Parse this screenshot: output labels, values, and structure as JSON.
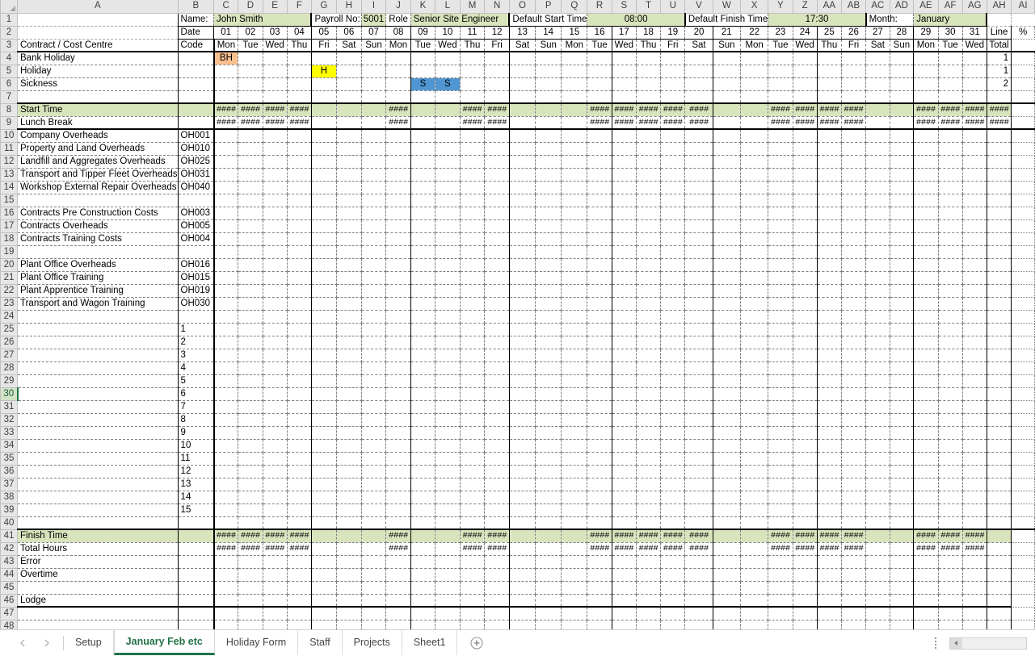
{
  "app": {
    "type": "spreadsheet",
    "active_cell_row": 30,
    "selected_row_header": "30"
  },
  "columns": [
    "A",
    "B",
    "C",
    "D",
    "E",
    "F",
    "G",
    "H",
    "I",
    "J",
    "K",
    "L",
    "M",
    "N",
    "O",
    "P",
    "Q",
    "R",
    "S",
    "T",
    "U",
    "V",
    "W",
    "X",
    "Y",
    "Z",
    "AA",
    "AB",
    "AC",
    "AD",
    "AE",
    "AF",
    "AG",
    "AH",
    "AI"
  ],
  "header": {
    "name_label": "Name:",
    "name_value": "John Smith",
    "payroll_label": "Payroll No:",
    "payroll_value": "5001",
    "role_label": "Role",
    "role_value": "Senior Site Engineer",
    "default_start_label": "Default Start Time",
    "default_start_value": "08:00",
    "default_finish_label": "Default Finish Time",
    "default_finish_value": "17:30",
    "month_label": "Month:",
    "month_value": "January",
    "date_label": "Date",
    "code_label": "Code",
    "contract_label": "Contract / Cost Centre",
    "line_total_label_1": "Line",
    "line_total_label_2": "Total",
    "percent_label": "%"
  },
  "calendar": {
    "dates": [
      "01",
      "02",
      "03",
      "04",
      "05",
      "06",
      "07",
      "08",
      "09",
      "10",
      "11",
      "12",
      "13",
      "14",
      "15",
      "16",
      "17",
      "18",
      "19",
      "20",
      "21",
      "22",
      "23",
      "24",
      "25",
      "26",
      "27",
      "28",
      "29",
      "30",
      "31"
    ],
    "days": [
      "Mon",
      "Tue",
      "Wed",
      "Thu",
      "Fri",
      "Sat",
      "Sun",
      "Mon",
      "Tue",
      "Wed",
      "Thu",
      "Fri",
      "Sat",
      "Sun",
      "Mon",
      "Tue",
      "Wed",
      "Thu",
      "Fri",
      "Sat",
      "Sun",
      "Mon",
      "Tue",
      "Wed",
      "Thu",
      "Fri",
      "Sat",
      "Sun",
      "Mon",
      "Tue",
      "Wed"
    ]
  },
  "absence_rows": [
    {
      "row": 4,
      "label": "Bank Holiday",
      "code": "",
      "total": "1",
      "marks": [
        {
          "day_index": 0,
          "text": "BH",
          "color": "#fac090"
        }
      ]
    },
    {
      "row": 5,
      "label": "Holiday",
      "code": "",
      "total": "1",
      "marks": [
        {
          "day_index": 4,
          "text": "H",
          "color": "#ffff00"
        }
      ]
    },
    {
      "row": 6,
      "label": "Sickness",
      "code": "",
      "total": "2",
      "marks": [
        {
          "day_index": 8,
          "text": "S",
          "color": "#4f96d2"
        },
        {
          "day_index": 9,
          "text": "S",
          "color": "#4f96d2"
        }
      ]
    }
  ],
  "time_rows": [
    {
      "row": 8,
      "label": "Start Time",
      "bold": true,
      "shaded": true,
      "hash_days": [
        0,
        1,
        2,
        3,
        7,
        10,
        11,
        15,
        16,
        17,
        18,
        19,
        22,
        23,
        24,
        25,
        28,
        29,
        30
      ],
      "total_hash": true
    },
    {
      "row": 9,
      "label": "Lunch Break",
      "bold": false,
      "shaded": false,
      "hash_days": [
        0,
        1,
        2,
        3,
        7,
        10,
        11,
        15,
        16,
        17,
        18,
        19,
        22,
        23,
        24,
        25,
        28,
        29,
        30
      ],
      "total_hash": true
    },
    {
      "row": 41,
      "label": "Finish Time",
      "bold": true,
      "shaded": true,
      "hash_days": [
        0,
        1,
        2,
        3,
        7,
        10,
        11,
        15,
        16,
        17,
        18,
        19,
        22,
        23,
        24,
        25,
        28,
        29,
        30
      ],
      "total_hash": false
    },
    {
      "row": 42,
      "label": "Total Hours",
      "bold": false,
      "shaded": false,
      "hash_days": [
        0,
        1,
        2,
        3,
        7,
        10,
        11,
        15,
        16,
        17,
        18,
        19,
        22,
        23,
        24,
        25,
        28,
        29,
        30
      ],
      "total_hash": false
    }
  ],
  "cost_centre_rows": [
    {
      "row": 10,
      "label": "Company Overheads",
      "code": "OH001"
    },
    {
      "row": 11,
      "label": "Property and Land Overheads",
      "code": "OH010"
    },
    {
      "row": 12,
      "label": "Landfill and Aggregates Overheads",
      "code": "OH025"
    },
    {
      "row": 13,
      "label": "Transport and Tipper Fleet Overheads",
      "code": "OH031"
    },
    {
      "row": 14,
      "label": "Workshop External Repair Overheads",
      "code": "OH040"
    },
    {
      "row": 15,
      "label": "",
      "code": ""
    },
    {
      "row": 16,
      "label": "Contracts Pre Construction Costs",
      "code": "OH003"
    },
    {
      "row": 17,
      "label": "Contracts Overheads",
      "code": "OH005"
    },
    {
      "row": 18,
      "label": "Contracts Training Costs",
      "code": "OH004"
    },
    {
      "row": 19,
      "label": "",
      "code": ""
    },
    {
      "row": 20,
      "label": "Plant Office Overheads",
      "code": "OH016"
    },
    {
      "row": 21,
      "label": "Plant Office Training",
      "code": "OH015"
    },
    {
      "row": 22,
      "label": "Plant Apprentice Training",
      "code": "OH019"
    },
    {
      "row": 23,
      "label": "Transport and Wagon Training",
      "code": "OH030"
    },
    {
      "row": 24,
      "label": "",
      "code": ""
    },
    {
      "row": 25,
      "label": "",
      "code": "1"
    },
    {
      "row": 26,
      "label": "",
      "code": "2"
    },
    {
      "row": 27,
      "label": "",
      "code": "3"
    },
    {
      "row": 28,
      "label": "",
      "code": "4"
    },
    {
      "row": 29,
      "label": "",
      "code": "5"
    },
    {
      "row": 30,
      "label": "",
      "code": "6"
    },
    {
      "row": 31,
      "label": "",
      "code": "7"
    },
    {
      "row": 32,
      "label": "",
      "code": "8"
    },
    {
      "row": 33,
      "label": "",
      "code": "9"
    },
    {
      "row": 34,
      "label": "",
      "code": "10"
    },
    {
      "row": 35,
      "label": "",
      "code": "11"
    },
    {
      "row": 36,
      "label": "",
      "code": "12"
    },
    {
      "row": 37,
      "label": "",
      "code": "13"
    },
    {
      "row": 38,
      "label": "",
      "code": "14"
    },
    {
      "row": 39,
      "label": "",
      "code": "15"
    },
    {
      "row": 40,
      "label": "",
      "code": ""
    }
  ],
  "footer_rows": [
    {
      "row": 43,
      "label": "Error",
      "bold": false
    },
    {
      "row": 44,
      "label": "Overtime",
      "bold": false
    },
    {
      "row": 45,
      "label": "",
      "bold": false
    },
    {
      "row": 46,
      "label": "Lodge",
      "bold": true
    },
    {
      "row": 47,
      "label": "",
      "bold": false
    },
    {
      "row": 48,
      "label": "",
      "bold": false
    }
  ],
  "sheet_tabs": [
    {
      "label": "Setup",
      "active": false
    },
    {
      "label": "January Feb etc",
      "active": true
    },
    {
      "label": "Holiday Form",
      "active": false
    },
    {
      "label": "Staff",
      "active": false
    },
    {
      "label": "Projects",
      "active": false
    },
    {
      "label": "Sheet1",
      "active": false
    }
  ],
  "tab_controls": {
    "prev_icon": "prev-sheet-icon",
    "next_icon": "next-sheet-icon",
    "add_icon": "add-sheet-icon"
  },
  "colors": {
    "accent_green": "#217346",
    "header_fill": "#d8e4bc",
    "bank_holiday": "#fac090",
    "holiday": "#ffff00",
    "sickness": "#4f96d2"
  }
}
